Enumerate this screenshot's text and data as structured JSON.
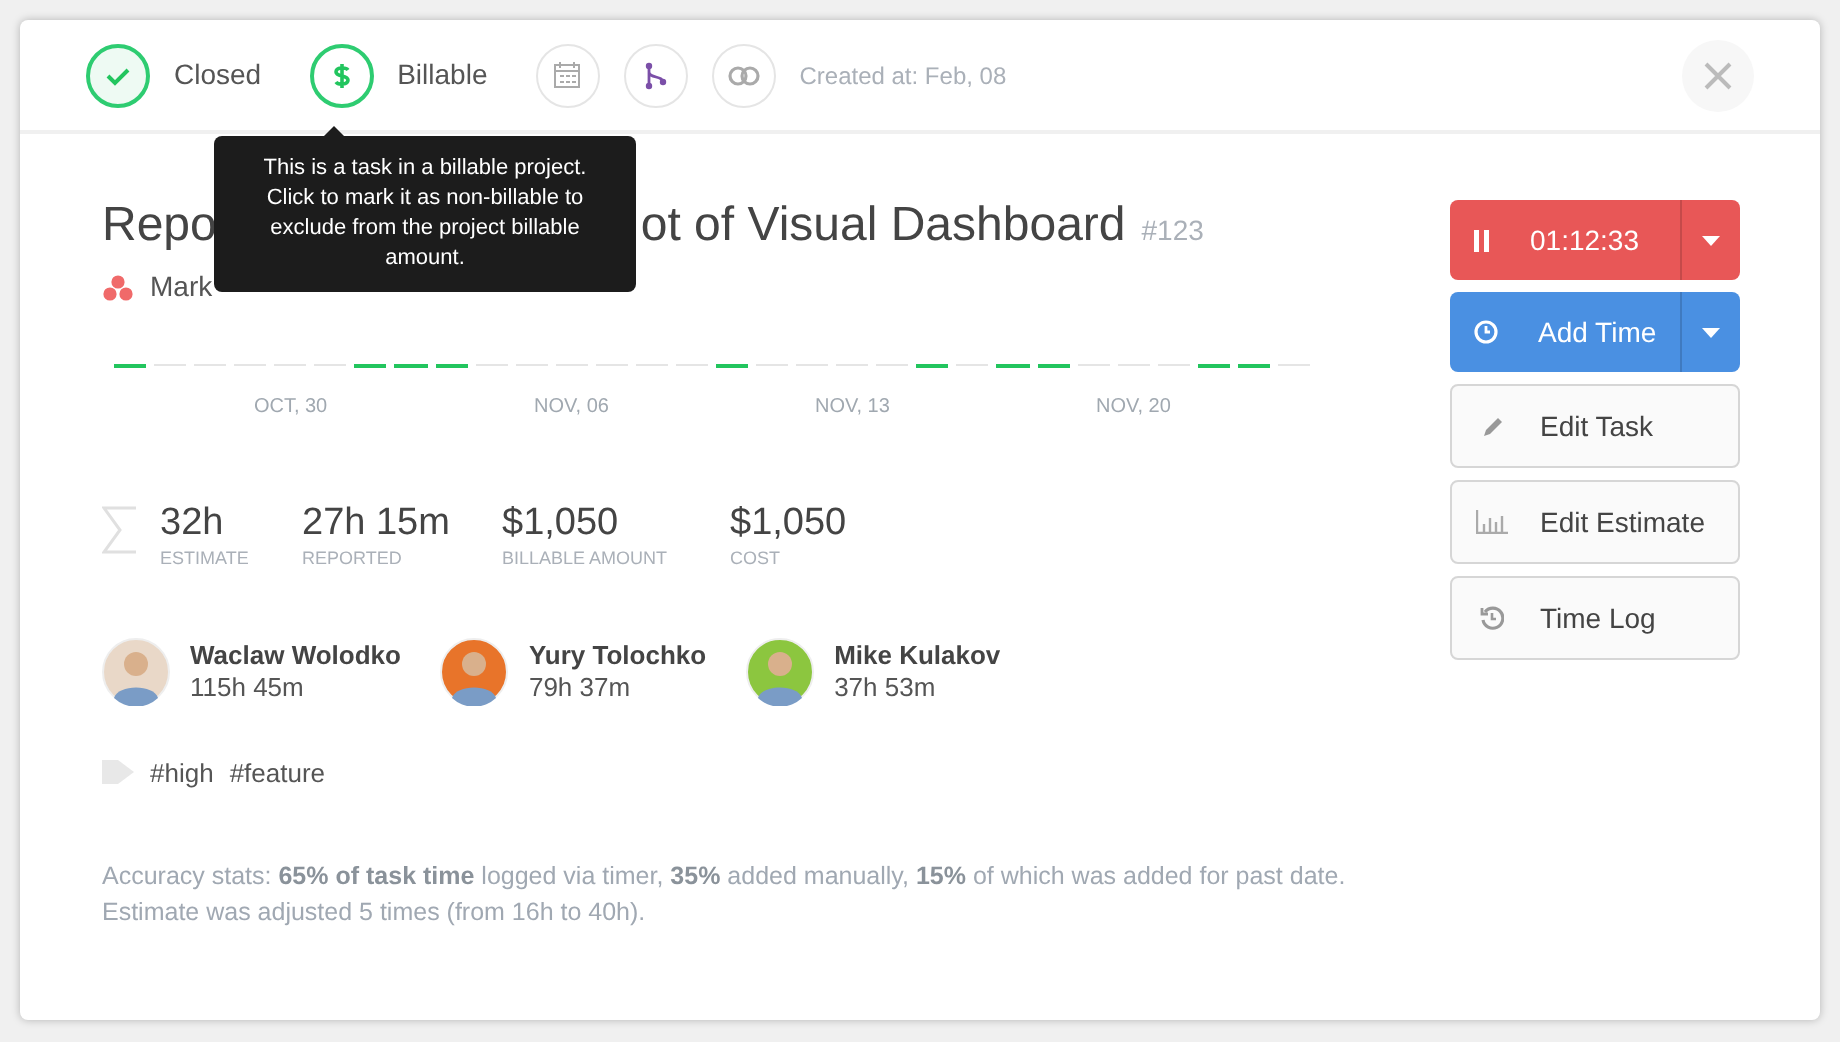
{
  "header": {
    "status": {
      "label": "Closed",
      "checked": true
    },
    "billing": {
      "label": "Billable",
      "checked": true
    },
    "created": "Created at: Feb, 08"
  },
  "tooltip": "This is a task in a billable project. Click to mark it as non-billable to exclude from the project billable amount.",
  "task": {
    "title_start": "Repo",
    "title_end": "ot of Visual Dashboard",
    "number": "#123",
    "project": "Mark"
  },
  "timeline": {
    "days": [
      {
        "logged": true
      },
      {
        "logged": false
      },
      {
        "logged": false
      },
      {
        "logged": false
      },
      {
        "logged": false
      },
      {
        "logged": false
      },
      {
        "logged": true
      },
      {
        "logged": true
      },
      {
        "logged": true
      },
      {
        "logged": false
      },
      {
        "logged": false
      },
      {
        "logged": false
      },
      {
        "logged": false
      },
      {
        "logged": false
      },
      {
        "logged": false
      },
      {
        "logged": true
      },
      {
        "logged": false
      },
      {
        "logged": false
      },
      {
        "logged": false
      },
      {
        "logged": false
      },
      {
        "logged": true
      },
      {
        "logged": false
      },
      {
        "logged": true
      },
      {
        "logged": true
      },
      {
        "logged": false
      },
      {
        "logged": false
      },
      {
        "logged": false
      },
      {
        "logged": true
      },
      {
        "logged": true
      },
      {
        "logged": false
      }
    ],
    "labels": [
      "OCT, 30",
      "NOV, 06",
      "NOV, 13",
      "NOV, 20"
    ]
  },
  "stats": [
    {
      "value": "32h",
      "label": "ESTIMATE"
    },
    {
      "value": "27h 15m",
      "label": "REPORTED"
    },
    {
      "value": "$1,050",
      "label": "BILLABLE AMOUNT"
    },
    {
      "value": "$1,050",
      "label": "COST"
    }
  ],
  "people": [
    {
      "name": "Waclaw Wolodko",
      "time": "115h 45m"
    },
    {
      "name": "Yury Tolochko",
      "time": "79h 37m"
    },
    {
      "name": "Mike Kulakov",
      "time": "37h 53m"
    }
  ],
  "tags": [
    "#high",
    "#feature"
  ],
  "accuracy": "Accuracy stats: **65% of task time** logged via timer, **35%** added manually, **15%** of which was added for past date. Estimate was adjusted 5 times (from 16h to 40h).",
  "actions": [
    {
      "kind": "timer",
      "label": "01:12:33"
    },
    {
      "kind": "add",
      "label": "Add Time"
    },
    {
      "kind": "edit",
      "label": "Edit Task"
    },
    {
      "kind": "estimate",
      "label": "Edit Estimate"
    },
    {
      "kind": "log",
      "label": "Time Log"
    }
  ]
}
